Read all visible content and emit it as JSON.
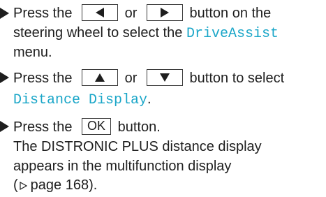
{
  "steps": [
    {
      "lines": [
        {
          "a": "Press the",
          "b": "or",
          "c": "button on the"
        },
        {
          "a": "steering wheel to select the",
          "term": "DriveAssist"
        },
        {
          "a": "menu."
        }
      ],
      "buttons": [
        "left-arrow",
        "right-arrow"
      ]
    },
    {
      "lines": [
        {
          "a": "Press the",
          "b": "or",
          "c": "button to select"
        },
        {
          "term": "Distance Display",
          "end": "."
        }
      ],
      "buttons": [
        "up-arrow",
        "down-arrow"
      ]
    },
    {
      "lines": [
        {
          "a": "Press the",
          "key": "OK",
          "c": "button."
        },
        {
          "a": "The DISTRONIC PLUS distance display"
        },
        {
          "a": "appears in the multifunction display"
        },
        {
          "open": "(",
          "ref": "page 168).",
          "ref_symbol": "page-reference-icon"
        }
      ]
    }
  ],
  "colors": {
    "text": "#1e1e1e",
    "accent_term": "#1aa6c8"
  }
}
